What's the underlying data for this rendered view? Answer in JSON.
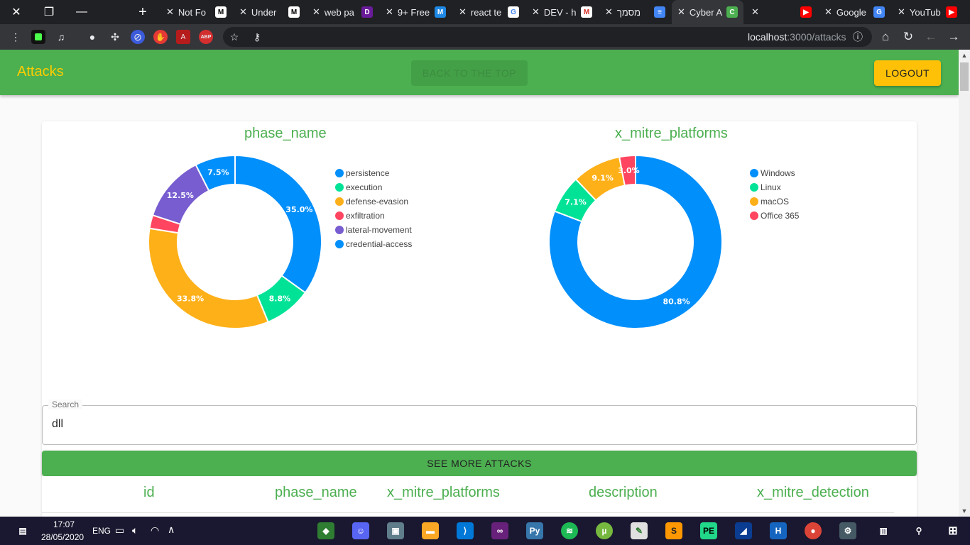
{
  "browser": {
    "tabs": [
      {
        "title": "Not Fo",
        "favicon": "M"
      },
      {
        "title": "Under",
        "favicon": "M"
      },
      {
        "title": "web pa",
        "favicon": "D"
      },
      {
        "title": "9+ Free",
        "favicon": "M"
      },
      {
        "title": "react te",
        "favicon": "G"
      },
      {
        "title": "DEV - h",
        "favicon": "M"
      },
      {
        "title": "מסמך",
        "favicon": "≡"
      },
      {
        "title": "Cyber A",
        "favicon": "C"
      },
      {
        "title": "",
        "favicon": "▶"
      },
      {
        "title": "Google",
        "favicon": "G"
      },
      {
        "title": "YouTub",
        "favicon": "▶"
      }
    ],
    "url_host": "localhost",
    "url_path": ":3000/attacks"
  },
  "appbar": {
    "brand": "Attacks",
    "back_to_top": "BACK TO THE TOP",
    "logout": "LOGOUT"
  },
  "chart_data": [
    {
      "type": "pie",
      "title": "phase_name",
      "categories": [
        "persistence",
        "execution",
        "defense-evasion",
        "exfiltration",
        "lateral-movement",
        "credential-access"
      ],
      "values": [
        35.0,
        8.8,
        33.8,
        2.5,
        12.5,
        7.5
      ],
      "labels": [
        "35.0%",
        "8.8%",
        "33.8%",
        "",
        "12.5%",
        "7.5%"
      ],
      "colors": [
        "#008ffb",
        "#00e396",
        "#feb019",
        "#ff4560",
        "#775dd0",
        "#008ffb"
      ],
      "legend": "right"
    },
    {
      "type": "pie",
      "title": "x_mitre_platforms",
      "categories": [
        "Windows",
        "Linux",
        "macOS",
        "Office 365"
      ],
      "values": [
        80.8,
        7.1,
        9.1,
        3.0
      ],
      "labels": [
        "80.8%",
        "7.1%",
        "9.1%",
        "3.0%"
      ],
      "colors": [
        "#008ffb",
        "#00e396",
        "#feb019",
        "#ff4560"
      ],
      "legend": "right"
    }
  ],
  "search": {
    "label": "Search",
    "value": "dll"
  },
  "see_more": "SEE MORE ATTACKS",
  "table": {
    "headers": [
      "id",
      "phase_name",
      "x_mitre_platforms",
      "description",
      "x_mitre_detection"
    ]
  },
  "taskbar": {
    "time": "17:07",
    "date": "28/05/2020",
    "lang": "ENG"
  }
}
